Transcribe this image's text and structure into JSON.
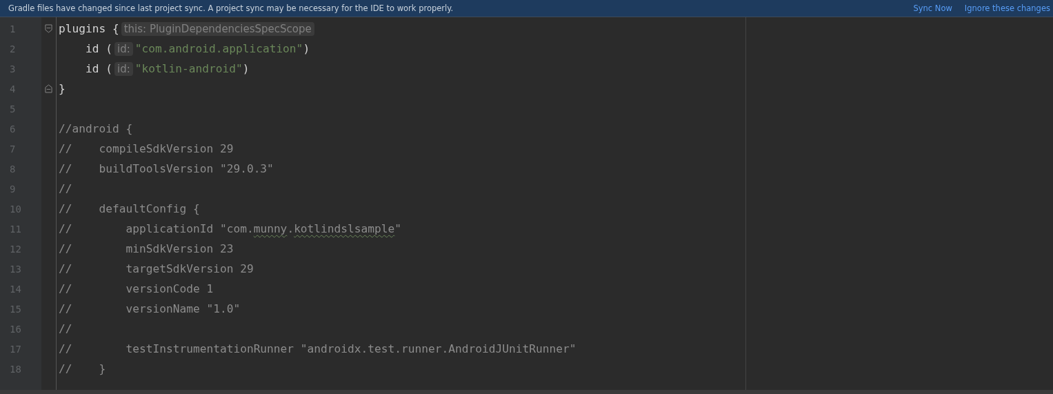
{
  "banner": {
    "message": "Gradle files have changed since last project sync. A project sync may be necessary for the IDE to work properly.",
    "actions": [
      "Sync Now",
      "Ignore these changes"
    ]
  },
  "editor": {
    "lines": [
      {
        "number": "1",
        "kind": "fold_start",
        "segments": [
          {
            "kind": "code",
            "text": "plugins {"
          },
          {
            "kind": "hint",
            "text": "this: PluginDependenciesSpecScope"
          }
        ]
      },
      {
        "number": "2",
        "segments": [
          {
            "kind": "code",
            "text": "    id ("
          },
          {
            "kind": "hint",
            "text": "id:"
          },
          {
            "kind": "string",
            "text": "\"com.android.application\""
          },
          {
            "kind": "code",
            "text": ")"
          }
        ]
      },
      {
        "number": "3",
        "segments": [
          {
            "kind": "code",
            "text": "    id ("
          },
          {
            "kind": "hint",
            "text": "id:"
          },
          {
            "kind": "string",
            "text": "\"kotlin-android\""
          },
          {
            "kind": "code",
            "text": ")"
          }
        ]
      },
      {
        "number": "4",
        "kind": "fold_end",
        "segments": [
          {
            "kind": "code",
            "text": "}"
          }
        ]
      },
      {
        "number": "5"
      },
      {
        "number": "6",
        "segments": [
          {
            "kind": "comment",
            "parts": [
              {
                "text": "//android {",
                "typo": false
              }
            ]
          }
        ]
      },
      {
        "number": "7",
        "segments": [
          {
            "kind": "comment",
            "parts": [
              {
                "text": "//    compileSdkVersion 29",
                "typo": false
              }
            ]
          }
        ]
      },
      {
        "number": "8",
        "segments": [
          {
            "kind": "comment",
            "parts": [
              {
                "text": "//    buildToolsVersion \"29.0.3\"",
                "typo": false
              }
            ]
          }
        ]
      },
      {
        "number": "9",
        "segments": [
          {
            "kind": "comment",
            "parts": [
              {
                "text": "//",
                "typo": false
              }
            ]
          }
        ]
      },
      {
        "number": "10",
        "segments": [
          {
            "kind": "comment",
            "parts": [
              {
                "text": "//    defaultConfig {",
                "typo": false
              }
            ]
          }
        ]
      },
      {
        "number": "11",
        "segments": [
          {
            "kind": "comment",
            "parts": [
              {
                "text": "//        applicationId \"com.",
                "typo": false
              },
              {
                "text": "munny",
                "typo": true
              },
              {
                "text": ".",
                "typo": false
              },
              {
                "text": "kotlindslsample",
                "typo": true
              },
              {
                "text": "\"",
                "typo": false
              }
            ]
          }
        ]
      },
      {
        "number": "12",
        "segments": [
          {
            "kind": "comment",
            "parts": [
              {
                "text": "//        minSdkVersion 23",
                "typo": false
              }
            ]
          }
        ]
      },
      {
        "number": "13",
        "segments": [
          {
            "kind": "comment",
            "parts": [
              {
                "text": "//        targetSdkVersion 29",
                "typo": false
              }
            ]
          }
        ]
      },
      {
        "number": "14",
        "segments": [
          {
            "kind": "comment",
            "parts": [
              {
                "text": "//        versionCode 1",
                "typo": false
              }
            ]
          }
        ]
      },
      {
        "number": "15",
        "segments": [
          {
            "kind": "comment",
            "parts": [
              {
                "text": "//        versionName \"1.0\"",
                "typo": false
              }
            ]
          }
        ]
      },
      {
        "number": "16",
        "segments": [
          {
            "kind": "comment",
            "parts": [
              {
                "text": "//",
                "typo": false
              }
            ]
          }
        ]
      },
      {
        "number": "17",
        "segments": [
          {
            "kind": "comment",
            "parts": [
              {
                "text": "//        testInstrumentationRunner \"androidx.test.runner.AndroidJUnitRunner\"",
                "typo": false
              }
            ]
          }
        ]
      },
      {
        "number": "18",
        "segments": [
          {
            "kind": "comment",
            "parts": [
              {
                "text": "//    }",
                "typo": false
              }
            ]
          }
        ]
      }
    ]
  }
}
